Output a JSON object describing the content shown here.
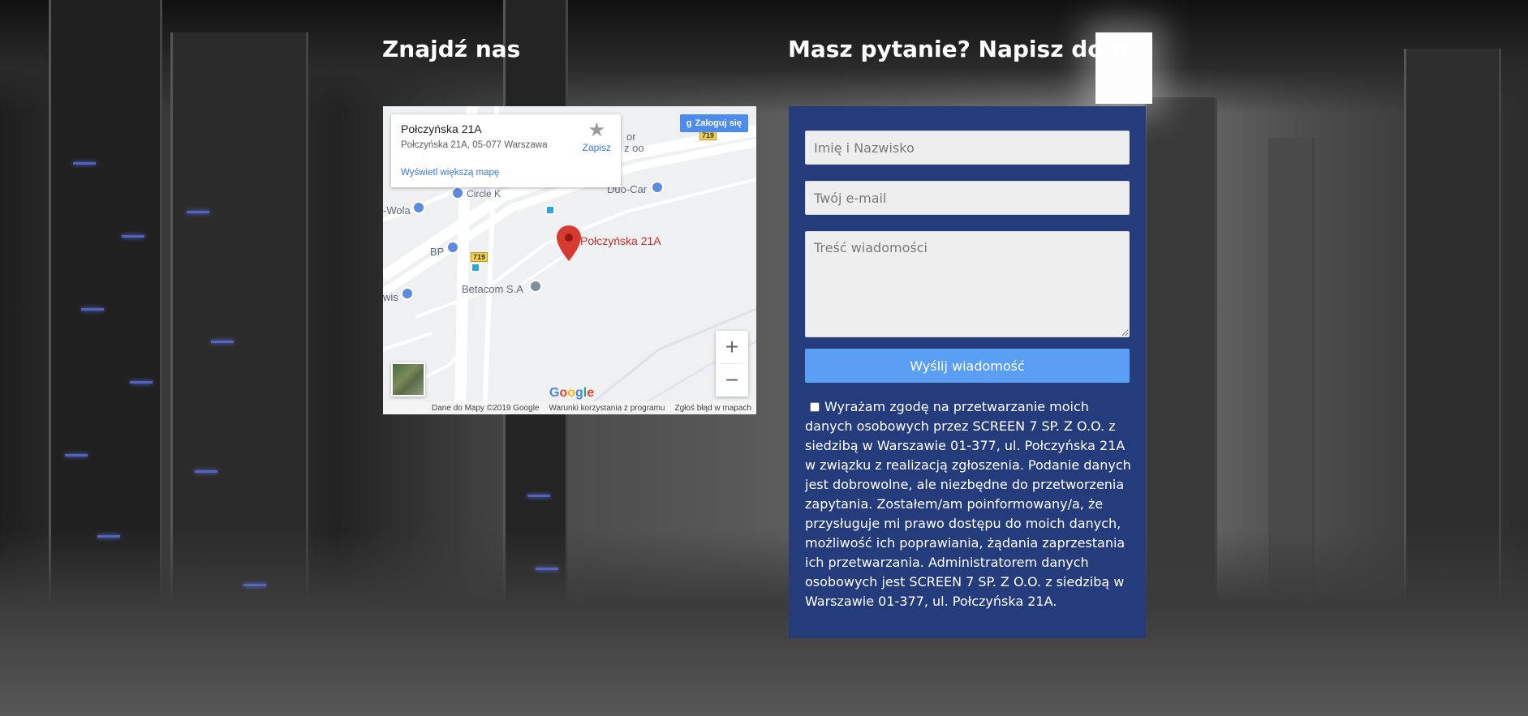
{
  "headings": {
    "find_us": "Znajdź nas",
    "contact": "Masz pytanie? Napisz do nas"
  },
  "map": {
    "place_title": "Połczyńska 21A",
    "place_address": "Połczyńska 21A, 05-077 Warszawa",
    "bigger_map_link": "Wyświetl większą mapę",
    "save_label": "Zapisz",
    "sign_in": "Zaloguj się",
    "pin_label": "Połczyńska 21A",
    "labels": {
      "circle_k": "Circle K",
      "duo_car": "Duo-Car",
      "wola": "-Wola",
      "bp": "BP",
      "betacom": "Betacom S.A",
      "wis": "wis",
      "oo": "z oo",
      "or": "or",
      "road_719": "719"
    },
    "footer": {
      "data": "Dane do Mapy ©2019 Google",
      "terms": "Warunki korzystania z programu",
      "report": "Zgłoś błąd w mapach"
    },
    "google_logo": [
      "G",
      "o",
      "o",
      "g",
      "l",
      "e"
    ]
  },
  "form": {
    "name_placeholder": "Imię i Nazwisko",
    "email_placeholder": "Twój e-mail",
    "message_placeholder": "Treść wiadomości",
    "send_label": "Wyślij wiadomość",
    "consent_text": "Wyrażam zgodę na przetwarzanie moich danych osobowych przez SCREEN 7 SP. Z O.O. z siedzibą w Warszawie 01-377, ul. Połczyńska 21A w związku z realizacją zgłoszenia. Podanie danych jest dobrowolne, ale niezbędne do przetworzenia zapytania. Zostałem/am poinformowany/a, że przysługuje mi prawo dostępu do moich danych, możliwość ich poprawiania, żądania zaprzestania ich przetwarzania. Administratorem danych osobowych jest SCREEN 7 SP. Z O.O. z siedzibą w Warszawie 01-377, ul. Połczyńska 21A."
  },
  "colors": {
    "form_bg": "#253c7c",
    "send_button": "#5a9ff4",
    "pin": "#d93a2f"
  }
}
